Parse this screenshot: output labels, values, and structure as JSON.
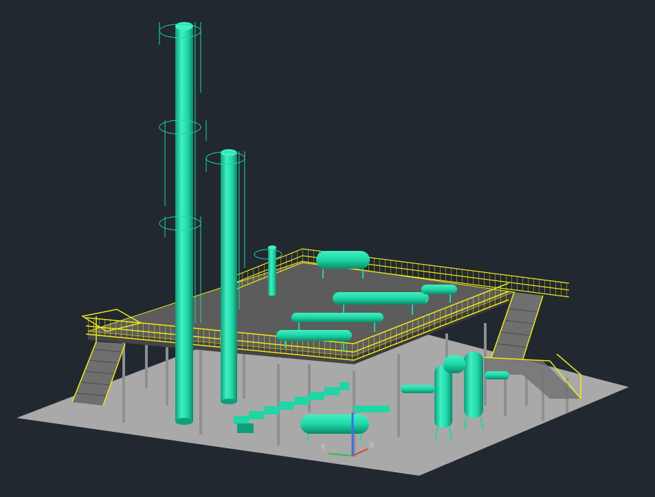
{
  "viewport": {
    "background": "#212830",
    "model_colors": {
      "equipment": "#1fd6a6",
      "equipment_dark": "#0f9f7a",
      "railing": "#f2ea18",
      "deck": "#5a5a5a",
      "ground": "#a9a9a9",
      "column_steel": "#8f8f8f",
      "stair": "#6f6f6f"
    },
    "ucs_icon": {
      "x_label": "X",
      "y_label": "Y",
      "z_axis_color": "#3f6fe6",
      "x_axis_color": "#e03a3a",
      "y_axis_color": "#2fbf3f"
    }
  }
}
